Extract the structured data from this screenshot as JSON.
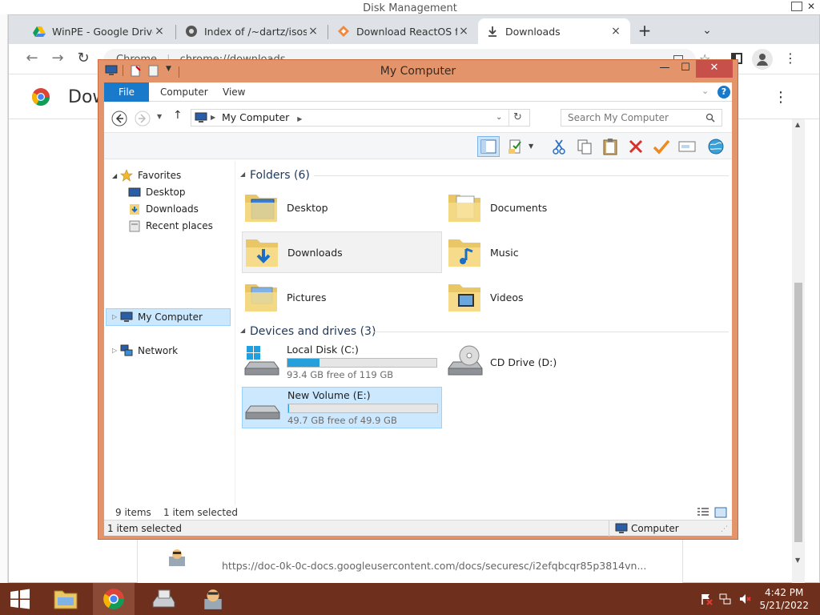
{
  "background_window": {
    "title": "Disk Management"
  },
  "browser": {
    "tabs": [
      {
        "title": "WinPE - Google Drive",
        "icon": "google-drive-icon",
        "close": "×"
      },
      {
        "title": "Index of /~dartz/isos/",
        "icon": "page-icon",
        "close": "×"
      },
      {
        "title": "Download ReactOS from",
        "icon": "reactos-icon",
        "close": "×"
      },
      {
        "title": "Downloads",
        "icon": "download-icon",
        "close": "×"
      }
    ],
    "new_tab": "+",
    "tab_search": "⌄",
    "address": {
      "origin": "Chrome",
      "url": "chrome://downloads"
    },
    "page_title": "Dow",
    "download_url": "https://doc-0k-0c-docs.googleusercontent.com/docs/securesc/i2efqbcqr85p3814vn...",
    "menu": "⋮"
  },
  "explorer": {
    "title": "My Computer",
    "window_buttons": {
      "minimize": "—",
      "maximize": "☐",
      "close": "✕"
    },
    "ribbon_tabs": [
      "File",
      "Computer",
      "View"
    ],
    "help": "?",
    "address": {
      "path": "My Computer"
    },
    "search": {
      "placeholder": "Search My Computer"
    },
    "nav_pane": {
      "favorites": "Favorites",
      "favorite_items": [
        "Desktop",
        "Downloads",
        "Recent places"
      ],
      "my_computer": "My Computer",
      "network": "Network"
    },
    "folders_group": "Folders (6)",
    "folders": [
      "Desktop",
      "Documents",
      "Downloads",
      "Music",
      "Pictures",
      "Videos"
    ],
    "devices_group": "Devices and drives (3)",
    "drives": [
      {
        "name": "Local Disk (C:)",
        "free_text": "93.4 GB free of 119 GB",
        "used_fraction": 0.215
      },
      {
        "name": "CD Drive (D:)"
      },
      {
        "name": "New Volume (E:)",
        "free_text": "49.7 GB free of 49.9 GB",
        "used_fraction": 0.004
      }
    ],
    "status": {
      "items": "9 items",
      "selected": "1 item selected"
    },
    "statusbar": {
      "left": "1 item selected",
      "right": "Computer"
    }
  },
  "taskbar": {
    "time": "4:42 PM",
    "date": "5/21/2022"
  },
  "colors": {
    "explorer_frame": "#e3946a",
    "ribbon_file": "#1979ca",
    "selection": "#cce8ff",
    "drive_bar": "#26a0da",
    "taskbar": "#6e2f1d"
  }
}
